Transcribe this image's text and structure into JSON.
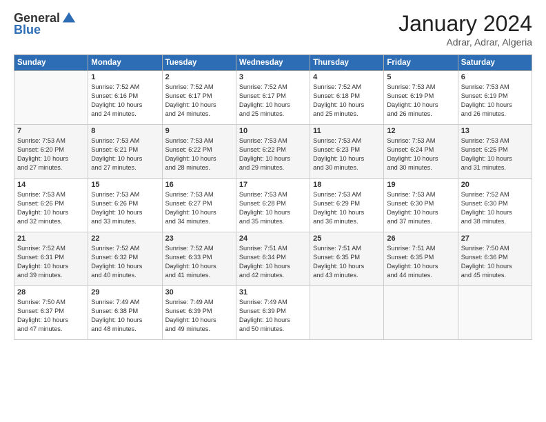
{
  "logo": {
    "general": "General",
    "blue": "Blue"
  },
  "header": {
    "title": "January 2024",
    "subtitle": "Adrar, Adrar, Algeria"
  },
  "days_of_week": [
    "Sunday",
    "Monday",
    "Tuesday",
    "Wednesday",
    "Thursday",
    "Friday",
    "Saturday"
  ],
  "weeks": [
    [
      {
        "day": "",
        "info": ""
      },
      {
        "day": "1",
        "info": "Sunrise: 7:52 AM\nSunset: 6:16 PM\nDaylight: 10 hours\nand 24 minutes."
      },
      {
        "day": "2",
        "info": "Sunrise: 7:52 AM\nSunset: 6:17 PM\nDaylight: 10 hours\nand 24 minutes."
      },
      {
        "day": "3",
        "info": "Sunrise: 7:52 AM\nSunset: 6:17 PM\nDaylight: 10 hours\nand 25 minutes."
      },
      {
        "day": "4",
        "info": "Sunrise: 7:52 AM\nSunset: 6:18 PM\nDaylight: 10 hours\nand 25 minutes."
      },
      {
        "day": "5",
        "info": "Sunrise: 7:53 AM\nSunset: 6:19 PM\nDaylight: 10 hours\nand 26 minutes."
      },
      {
        "day": "6",
        "info": "Sunrise: 7:53 AM\nSunset: 6:19 PM\nDaylight: 10 hours\nand 26 minutes."
      }
    ],
    [
      {
        "day": "7",
        "info": "Sunrise: 7:53 AM\nSunset: 6:20 PM\nDaylight: 10 hours\nand 27 minutes."
      },
      {
        "day": "8",
        "info": "Sunrise: 7:53 AM\nSunset: 6:21 PM\nDaylight: 10 hours\nand 27 minutes."
      },
      {
        "day": "9",
        "info": "Sunrise: 7:53 AM\nSunset: 6:22 PM\nDaylight: 10 hours\nand 28 minutes."
      },
      {
        "day": "10",
        "info": "Sunrise: 7:53 AM\nSunset: 6:22 PM\nDaylight: 10 hours\nand 29 minutes."
      },
      {
        "day": "11",
        "info": "Sunrise: 7:53 AM\nSunset: 6:23 PM\nDaylight: 10 hours\nand 30 minutes."
      },
      {
        "day": "12",
        "info": "Sunrise: 7:53 AM\nSunset: 6:24 PM\nDaylight: 10 hours\nand 30 minutes."
      },
      {
        "day": "13",
        "info": "Sunrise: 7:53 AM\nSunset: 6:25 PM\nDaylight: 10 hours\nand 31 minutes."
      }
    ],
    [
      {
        "day": "14",
        "info": "Sunrise: 7:53 AM\nSunset: 6:26 PM\nDaylight: 10 hours\nand 32 minutes."
      },
      {
        "day": "15",
        "info": "Sunrise: 7:53 AM\nSunset: 6:26 PM\nDaylight: 10 hours\nand 33 minutes."
      },
      {
        "day": "16",
        "info": "Sunrise: 7:53 AM\nSunset: 6:27 PM\nDaylight: 10 hours\nand 34 minutes."
      },
      {
        "day": "17",
        "info": "Sunrise: 7:53 AM\nSunset: 6:28 PM\nDaylight: 10 hours\nand 35 minutes."
      },
      {
        "day": "18",
        "info": "Sunrise: 7:53 AM\nSunset: 6:29 PM\nDaylight: 10 hours\nand 36 minutes."
      },
      {
        "day": "19",
        "info": "Sunrise: 7:53 AM\nSunset: 6:30 PM\nDaylight: 10 hours\nand 37 minutes."
      },
      {
        "day": "20",
        "info": "Sunrise: 7:52 AM\nSunset: 6:30 PM\nDaylight: 10 hours\nand 38 minutes."
      }
    ],
    [
      {
        "day": "21",
        "info": "Sunrise: 7:52 AM\nSunset: 6:31 PM\nDaylight: 10 hours\nand 39 minutes."
      },
      {
        "day": "22",
        "info": "Sunrise: 7:52 AM\nSunset: 6:32 PM\nDaylight: 10 hours\nand 40 minutes."
      },
      {
        "day": "23",
        "info": "Sunrise: 7:52 AM\nSunset: 6:33 PM\nDaylight: 10 hours\nand 41 minutes."
      },
      {
        "day": "24",
        "info": "Sunrise: 7:51 AM\nSunset: 6:34 PM\nDaylight: 10 hours\nand 42 minutes."
      },
      {
        "day": "25",
        "info": "Sunrise: 7:51 AM\nSunset: 6:35 PM\nDaylight: 10 hours\nand 43 minutes."
      },
      {
        "day": "26",
        "info": "Sunrise: 7:51 AM\nSunset: 6:35 PM\nDaylight: 10 hours\nand 44 minutes."
      },
      {
        "day": "27",
        "info": "Sunrise: 7:50 AM\nSunset: 6:36 PM\nDaylight: 10 hours\nand 45 minutes."
      }
    ],
    [
      {
        "day": "28",
        "info": "Sunrise: 7:50 AM\nSunset: 6:37 PM\nDaylight: 10 hours\nand 47 minutes."
      },
      {
        "day": "29",
        "info": "Sunrise: 7:49 AM\nSunset: 6:38 PM\nDaylight: 10 hours\nand 48 minutes."
      },
      {
        "day": "30",
        "info": "Sunrise: 7:49 AM\nSunset: 6:39 PM\nDaylight: 10 hours\nand 49 minutes."
      },
      {
        "day": "31",
        "info": "Sunrise: 7:49 AM\nSunset: 6:39 PM\nDaylight: 10 hours\nand 50 minutes."
      },
      {
        "day": "",
        "info": ""
      },
      {
        "day": "",
        "info": ""
      },
      {
        "day": "",
        "info": ""
      }
    ]
  ]
}
